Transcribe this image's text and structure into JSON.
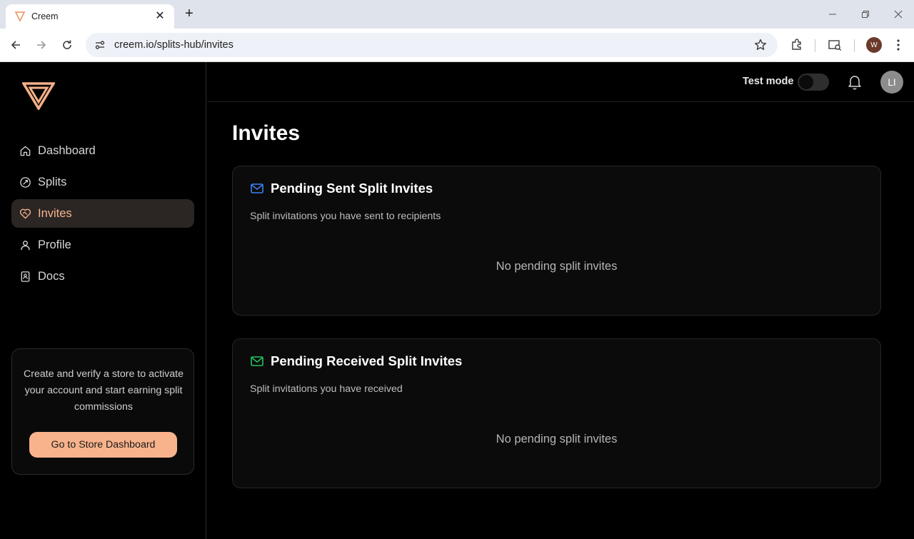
{
  "browser": {
    "tab_title": "Creem",
    "url": "creem.io/splits-hub/invites",
    "profile_initial": "W"
  },
  "sidebar": {
    "items": [
      {
        "label": "Dashboard",
        "icon": "home-icon",
        "active": false
      },
      {
        "label": "Splits",
        "icon": "split-icon",
        "active": false
      },
      {
        "label": "Invites",
        "icon": "heart-handshake-icon",
        "active": true
      },
      {
        "label": "Profile",
        "icon": "user-icon",
        "active": false
      },
      {
        "label": "Docs",
        "icon": "book-icon",
        "active": false
      }
    ],
    "promo": {
      "text": "Create and verify a store to activate your account and start earning split commissions",
      "button": "Go to Store Dashboard"
    }
  },
  "topbar": {
    "test_mode_label": "Test mode",
    "test_mode_on": false,
    "avatar_initials": "LI"
  },
  "page": {
    "title": "Invites",
    "cards": [
      {
        "title": "Pending Sent Split Invites",
        "subtitle": "Split invitations you have sent to recipients",
        "empty": "No pending split invites",
        "icon_color": "#3b82f6"
      },
      {
        "title": "Pending Received Split Invites",
        "subtitle": "Split invitations you have received",
        "empty": "No pending split invites",
        "icon_color": "#22c55e"
      }
    ]
  },
  "colors": {
    "accent": "#f8b38c",
    "background": "#000000"
  }
}
